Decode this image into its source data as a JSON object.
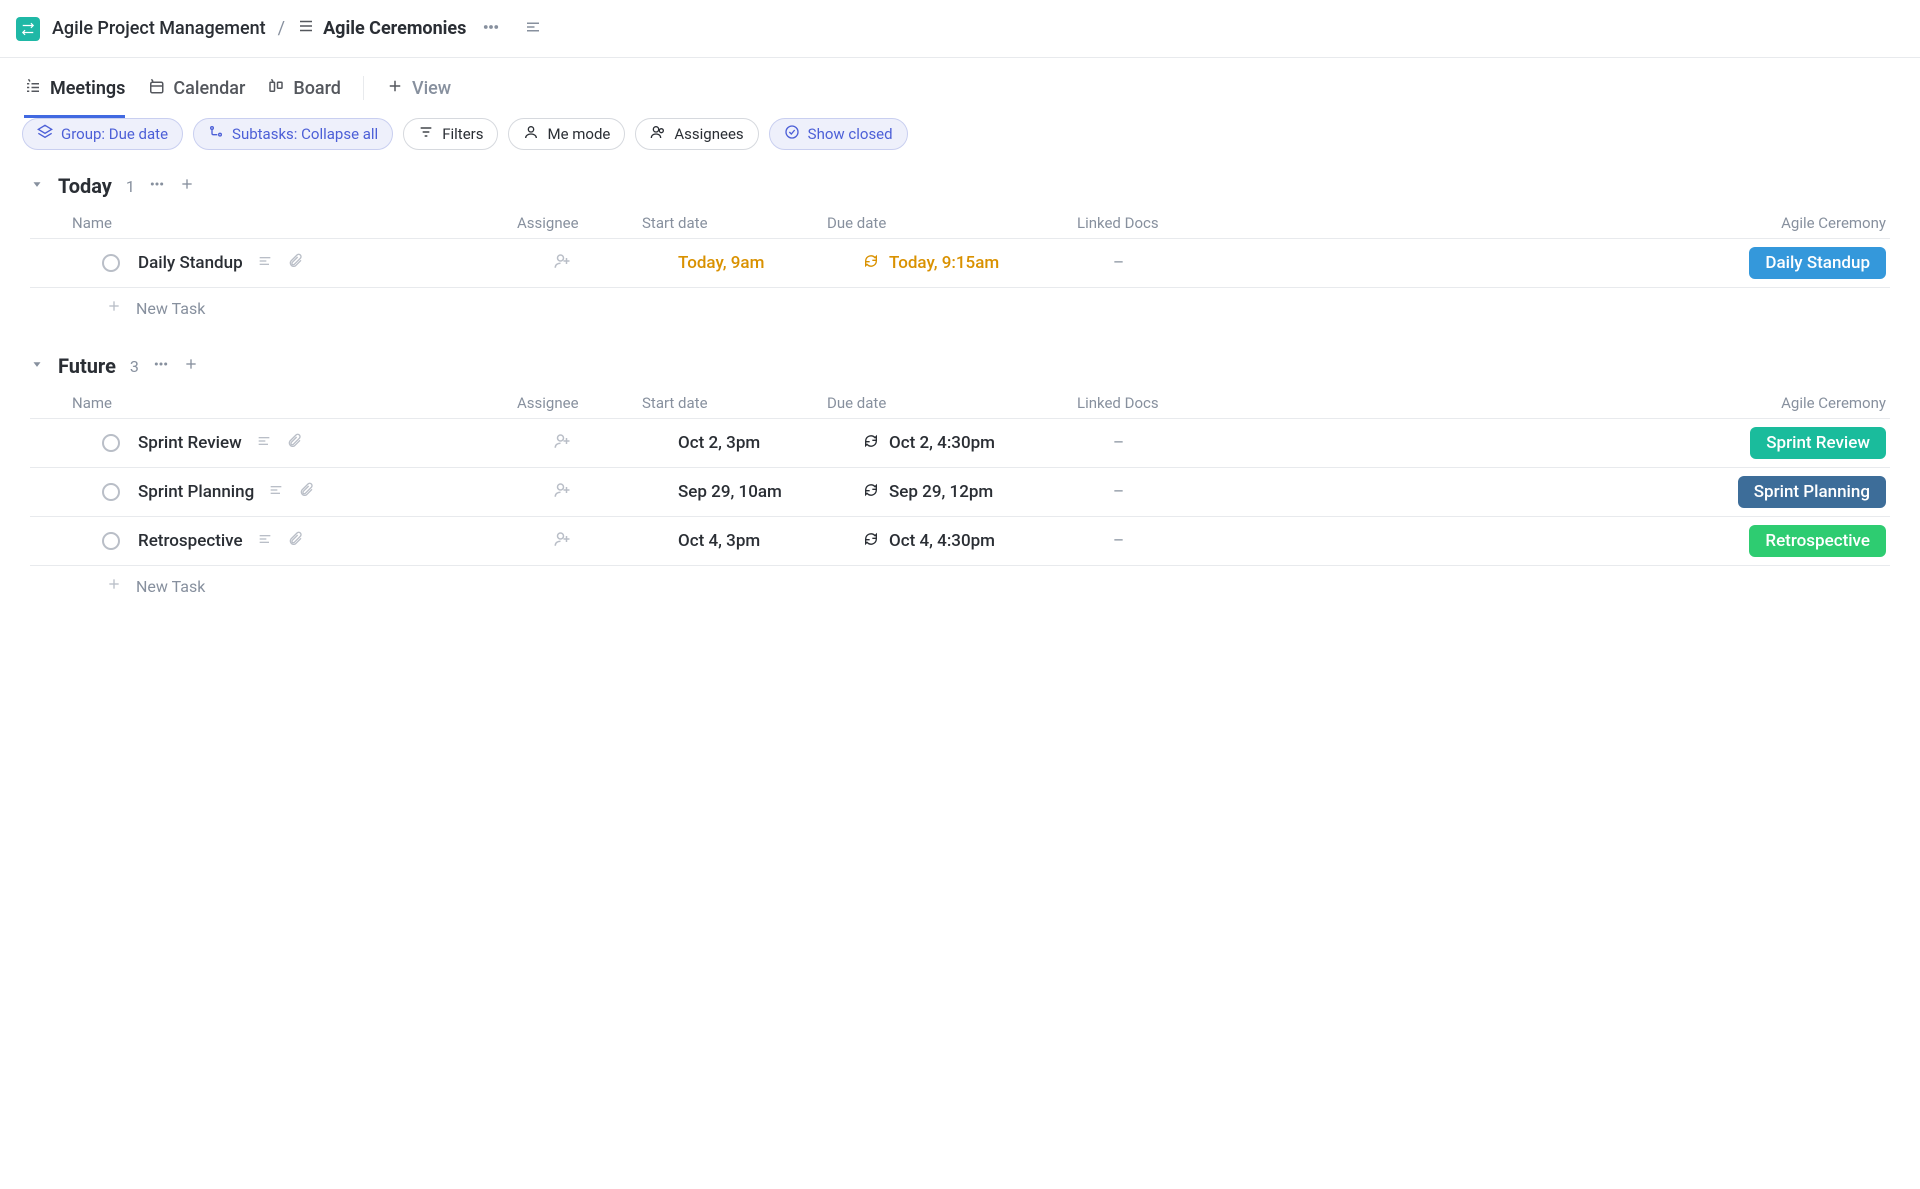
{
  "breadcrumb": {
    "parent": "Agile Project Management",
    "current": "Agile Ceremonies"
  },
  "tabs": {
    "meetings": "Meetings",
    "calendar": "Calendar",
    "board": "Board",
    "add_view": "View"
  },
  "toolbar": {
    "group": "Group: Due date",
    "subtasks": "Subtasks: Collapse all",
    "filters": "Filters",
    "me_mode": "Me mode",
    "assignees": "Assignees",
    "show_closed": "Show closed"
  },
  "columns": {
    "name": "Name",
    "assignee": "Assignee",
    "start": "Start date",
    "due": "Due date",
    "docs": "Linked Docs",
    "ceremony": "Agile Ceremony"
  },
  "new_task": "New Task",
  "groups": [
    {
      "title": "Today",
      "count": "1",
      "rows": [
        {
          "name": "Daily Standup",
          "start": "Today, 9am",
          "due": "Today, 9:15am",
          "docs": "–",
          "tag": "Daily Standup",
          "tag_color": "tag-blue",
          "date_color": "amber"
        }
      ]
    },
    {
      "title": "Future",
      "count": "3",
      "rows": [
        {
          "name": "Sprint Review",
          "start": "Oct 2, 3pm",
          "due": "Oct 2, 4:30pm",
          "docs": "–",
          "tag": "Sprint Review",
          "tag_color": "tag-teal",
          "date_color": "neutral"
        },
        {
          "name": "Sprint Planning",
          "start": "Sep 29, 10am",
          "due": "Sep 29, 12pm",
          "docs": "–",
          "tag": "Sprint Planning",
          "tag_color": "tag-steel",
          "date_color": "neutral"
        },
        {
          "name": "Retrospective",
          "start": "Oct 4, 3pm",
          "due": "Oct 4, 4:30pm",
          "docs": "–",
          "tag": "Retrospective",
          "tag_color": "tag-green",
          "date_color": "neutral"
        }
      ]
    }
  ]
}
